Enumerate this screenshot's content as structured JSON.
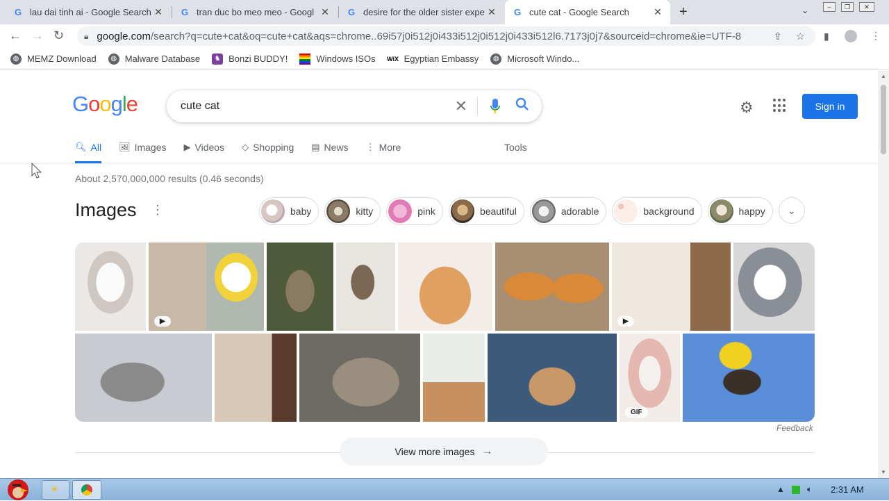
{
  "browser": {
    "tabs": [
      {
        "title": "lau dai tinh ai - Google Search",
        "active": false
      },
      {
        "title": "tran duc bo meo meo - Googl",
        "active": false
      },
      {
        "title": "desire for the older sister expe",
        "active": false
      },
      {
        "title": "cute cat - Google Search",
        "active": true
      }
    ],
    "url_main": "google.com",
    "url_rest": "/search?q=cute+cat&oq=cute+cat&aqs=chrome..69i57j0i512j0i433i512j0i512j0i433i512l6.7173j0j7&sourceid=chrome&ie=UTF-8",
    "bookmarks": [
      {
        "label": "MEMZ Download",
        "icon": "globe-icon"
      },
      {
        "label": "Malware Database",
        "icon": "globe-icon"
      },
      {
        "label": "Bonzi BUDDY!",
        "icon": "bonzi-icon"
      },
      {
        "label": "Windows ISOs",
        "icon": "windows-icon"
      },
      {
        "label": "Egyptian Embassy",
        "icon": "wix-icon"
      },
      {
        "label": "Microsoft Windo...",
        "icon": "globe-icon"
      }
    ]
  },
  "google": {
    "logo": [
      "G",
      "o",
      "o",
      "g",
      "l",
      "e"
    ],
    "query": "cute cat",
    "signin_label": "Sign in",
    "tabs": [
      {
        "label": "All",
        "icon": "search-icon",
        "active": true
      },
      {
        "label": "Images",
        "icon": "image-icon",
        "active": false
      },
      {
        "label": "Videos",
        "icon": "video-icon",
        "active": false
      },
      {
        "label": "Shopping",
        "icon": "tag-icon",
        "active": false
      },
      {
        "label": "News",
        "icon": "news-icon",
        "active": false
      },
      {
        "label": "More",
        "icon": "more-vert-icon",
        "active": false
      }
    ],
    "tools_label": "Tools",
    "result_stats": "About 2,570,000,000 results (0.46 seconds)",
    "images_heading": "Images",
    "chips": [
      "baby",
      "kitty",
      "pink",
      "beautiful",
      "adorable",
      "background",
      "happy"
    ],
    "image_badges": {
      "play": "▶",
      "gif": "GIF"
    },
    "feedback_label": "Feedback",
    "view_more_label": "View more images"
  },
  "taskbar": {
    "clock": "2:31 AM"
  },
  "colors": {
    "accent": "#1a73e8",
    "tabbar": "#dee1e6",
    "taskbar": "#8ab2d9"
  }
}
